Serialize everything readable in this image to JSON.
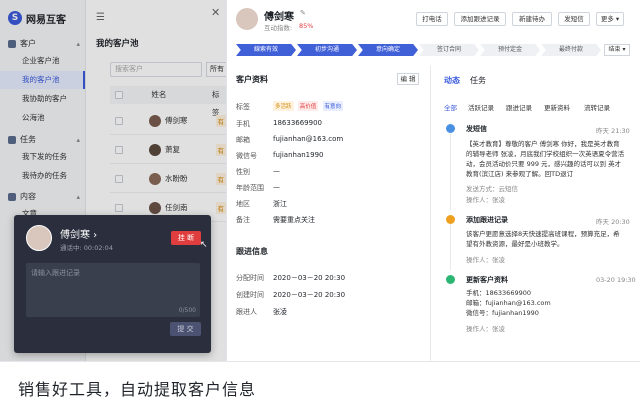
{
  "app": {
    "name": "网易互客"
  },
  "sidebar": {
    "sections": [
      {
        "label": "客户",
        "items": [
          "企业客户池",
          "我的客户池",
          "我协助的客户",
          "公海池"
        ]
      },
      {
        "label": "任务",
        "items": [
          "我下发的任务",
          "我待办的任务"
        ]
      },
      {
        "label": "内容",
        "items": [
          "文章"
        ]
      }
    ],
    "active_item": "我的客户池"
  },
  "list": {
    "title": "我的客户池",
    "search_placeholder": "搜索客户",
    "filter_label": "所有",
    "columns": [
      "姓名",
      "标签"
    ],
    "rows": [
      {
        "name": "傅剑寒",
        "tag": "有"
      },
      {
        "name": "萧复",
        "tag": "有"
      },
      {
        "name": "水盼盼",
        "tag": "有"
      },
      {
        "name": "任剑南",
        "tag": "有"
      }
    ]
  },
  "call": {
    "name": "傅剑寒 ›",
    "status": "通话中: 00:02:04",
    "hangup_label": "挂 断",
    "note_placeholder": "请输入跟进记录",
    "count": "0/500",
    "submit_label": "提 交"
  },
  "detail": {
    "name": "傅剑寒",
    "score_label": "互动指数:",
    "score_value": "85%",
    "actions": [
      "打电话",
      "添加跟进记录",
      "新建待办",
      "发短信",
      "更多 ▾"
    ],
    "stages": [
      "線索有效",
      "初步沟通",
      "意向确定",
      "签订合同",
      "预付定金",
      "最终付款"
    ],
    "stage_done_count": 3,
    "stage_end_label": "结束 ▾",
    "profile": {
      "title": "客户资料",
      "edit_label": "编 辑",
      "fields": [
        {
          "label": "标签",
          "value": ""
        },
        {
          "label": "手机",
          "value": "18633669900"
        },
        {
          "label": "邮箱",
          "value": "fujianhan@163.com"
        },
        {
          "label": "微信号",
          "value": "fujianhan1990"
        },
        {
          "label": "性别",
          "value": "—"
        },
        {
          "label": "年龄范围",
          "value": "—"
        },
        {
          "label": "地区",
          "value": "浙江"
        },
        {
          "label": "备注",
          "value": "需要重点关注"
        }
      ],
      "tags": [
        "多活跃",
        "高价值",
        "有意向"
      ]
    },
    "follow": {
      "title": "跟进信息",
      "fields": [
        {
          "label": "分配时间",
          "value": "2020－03－20  20:30"
        },
        {
          "label": "创建时间",
          "value": "2020－03－20  20:30"
        },
        {
          "label": "跟进人",
          "value": "张凌"
        }
      ]
    }
  },
  "activity": {
    "tabs": [
      "动态",
      "任务"
    ],
    "filters": [
      "全部",
      "活跃记录",
      "跟进记录",
      "更新资料",
      "流转记录"
    ],
    "items": [
      {
        "title": "发短信",
        "time": "昨天 21:30",
        "text": "【英才教育】尊敬的客户 傅剑寒 你好，我是英才教育的辅导老师 张凌，月底我们学校组织一次英语夏令营活动，会员活动价只要 999 元，感兴趣的话可以到 英才教育(滨江店) 来参观了解。回TD退订",
        "sub1": "发送方式：云短信",
        "sub2": "操作人：张凌"
      },
      {
        "title": "添加跟进记录",
        "time": "昨天 20:30",
        "text": "该客户更愿意选择8天快速提高班课程，预算充足，希望有外教资源，最好是小班教学。",
        "sub1": "操作人：张凌",
        "sub2": ""
      },
      {
        "title": "更新客户资料",
        "time": "03-20  19:30",
        "text": "手机：18633669900\n邮箱：fujianhan@163.com\n微信号：fujianhan1990",
        "sub1": "操作人：张凌",
        "sub2": ""
      }
    ]
  },
  "video": {
    "timer": "00:13"
  },
  "caption": "销售好工具，自动提取客户信息"
}
